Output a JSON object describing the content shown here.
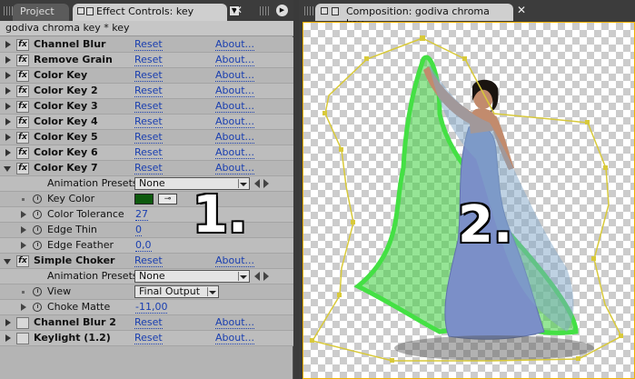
{
  "left_panel": {
    "tabs": {
      "project": "Project",
      "effect_controls": "Effect Controls: key"
    },
    "title": "godiva chroma key * key",
    "reset_label": "Reset",
    "about_label": "About...",
    "effects": [
      {
        "name": "Channel Blur"
      },
      {
        "name": "Remove Grain"
      },
      {
        "name": "Color Key"
      },
      {
        "name": "Color Key 2"
      },
      {
        "name": "Color Key 3"
      },
      {
        "name": "Color Key 4"
      },
      {
        "name": "Color Key 5"
      },
      {
        "name": "Color Key 6"
      },
      {
        "name": "Color Key 7"
      }
    ],
    "color_key_7": {
      "animation_presets_label": "Animation Presets:",
      "presets_value": "None",
      "key_color_label": "Key Color",
      "key_color": "#0e5a0e",
      "color_tolerance_label": "Color Tolerance",
      "color_tolerance": "27",
      "edge_thin_label": "Edge Thin",
      "edge_thin": "0",
      "edge_feather_label": "Edge Feather",
      "edge_feather": "0,0"
    },
    "simple_choker": {
      "name": "Simple Choker",
      "animation_presets_label": "Animation Presets:",
      "presets_value": "None",
      "view_label": "View",
      "view_value": "Final Output",
      "choke_matte_label": "Choke Matte",
      "choke_matte": "-11,00"
    },
    "disabled_effects": [
      {
        "name": "Channel Blur 2"
      },
      {
        "name": "Keylight (1.2)"
      }
    ],
    "annotation": "1."
  },
  "composition": {
    "tab": "Composition: godiva chroma key",
    "annotation": "2.",
    "mask_color": "#d8c93a"
  }
}
